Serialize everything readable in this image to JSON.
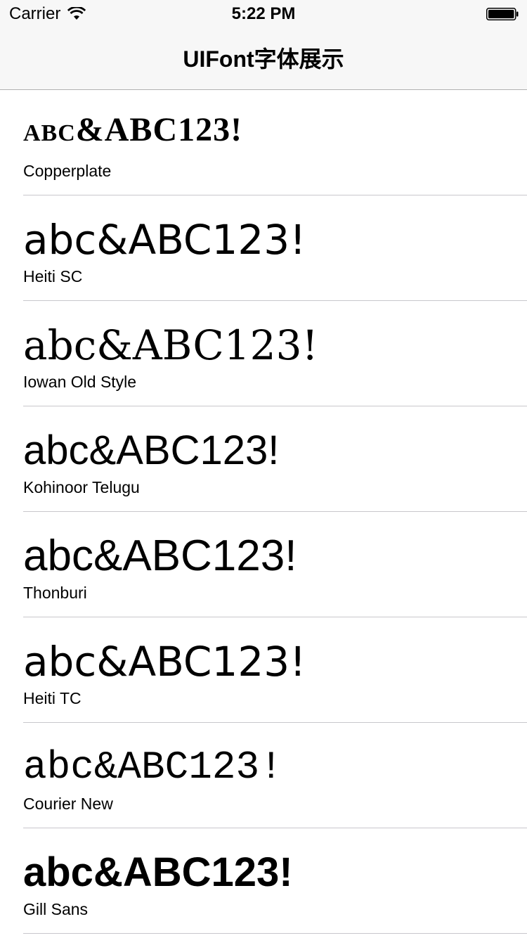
{
  "status_bar": {
    "carrier": "Carrier",
    "time": "5:22 PM"
  },
  "nav": {
    "title": "UIFont字体展示"
  },
  "sample_text": "abc&ABC123!",
  "fonts": [
    {
      "sample": "abc&ABC123!",
      "name": "Copperplate"
    },
    {
      "sample": "abc&ABC123!",
      "name": "Heiti SC"
    },
    {
      "sample": "abc&ABC123!",
      "name": "Iowan Old Style"
    },
    {
      "sample": "abc&ABC123!",
      "name": "Kohinoor Telugu"
    },
    {
      "sample": "abc&ABC123!",
      "name": "Thonburi"
    },
    {
      "sample": "abc&ABC123!",
      "name": "Heiti TC"
    },
    {
      "sample": "abc&ABC123!",
      "name": "Courier New"
    },
    {
      "sample": "abc&ABC123!",
      "name": "Gill Sans"
    }
  ],
  "icons": {
    "wifi": "wifi-icon",
    "battery": "battery-icon"
  }
}
